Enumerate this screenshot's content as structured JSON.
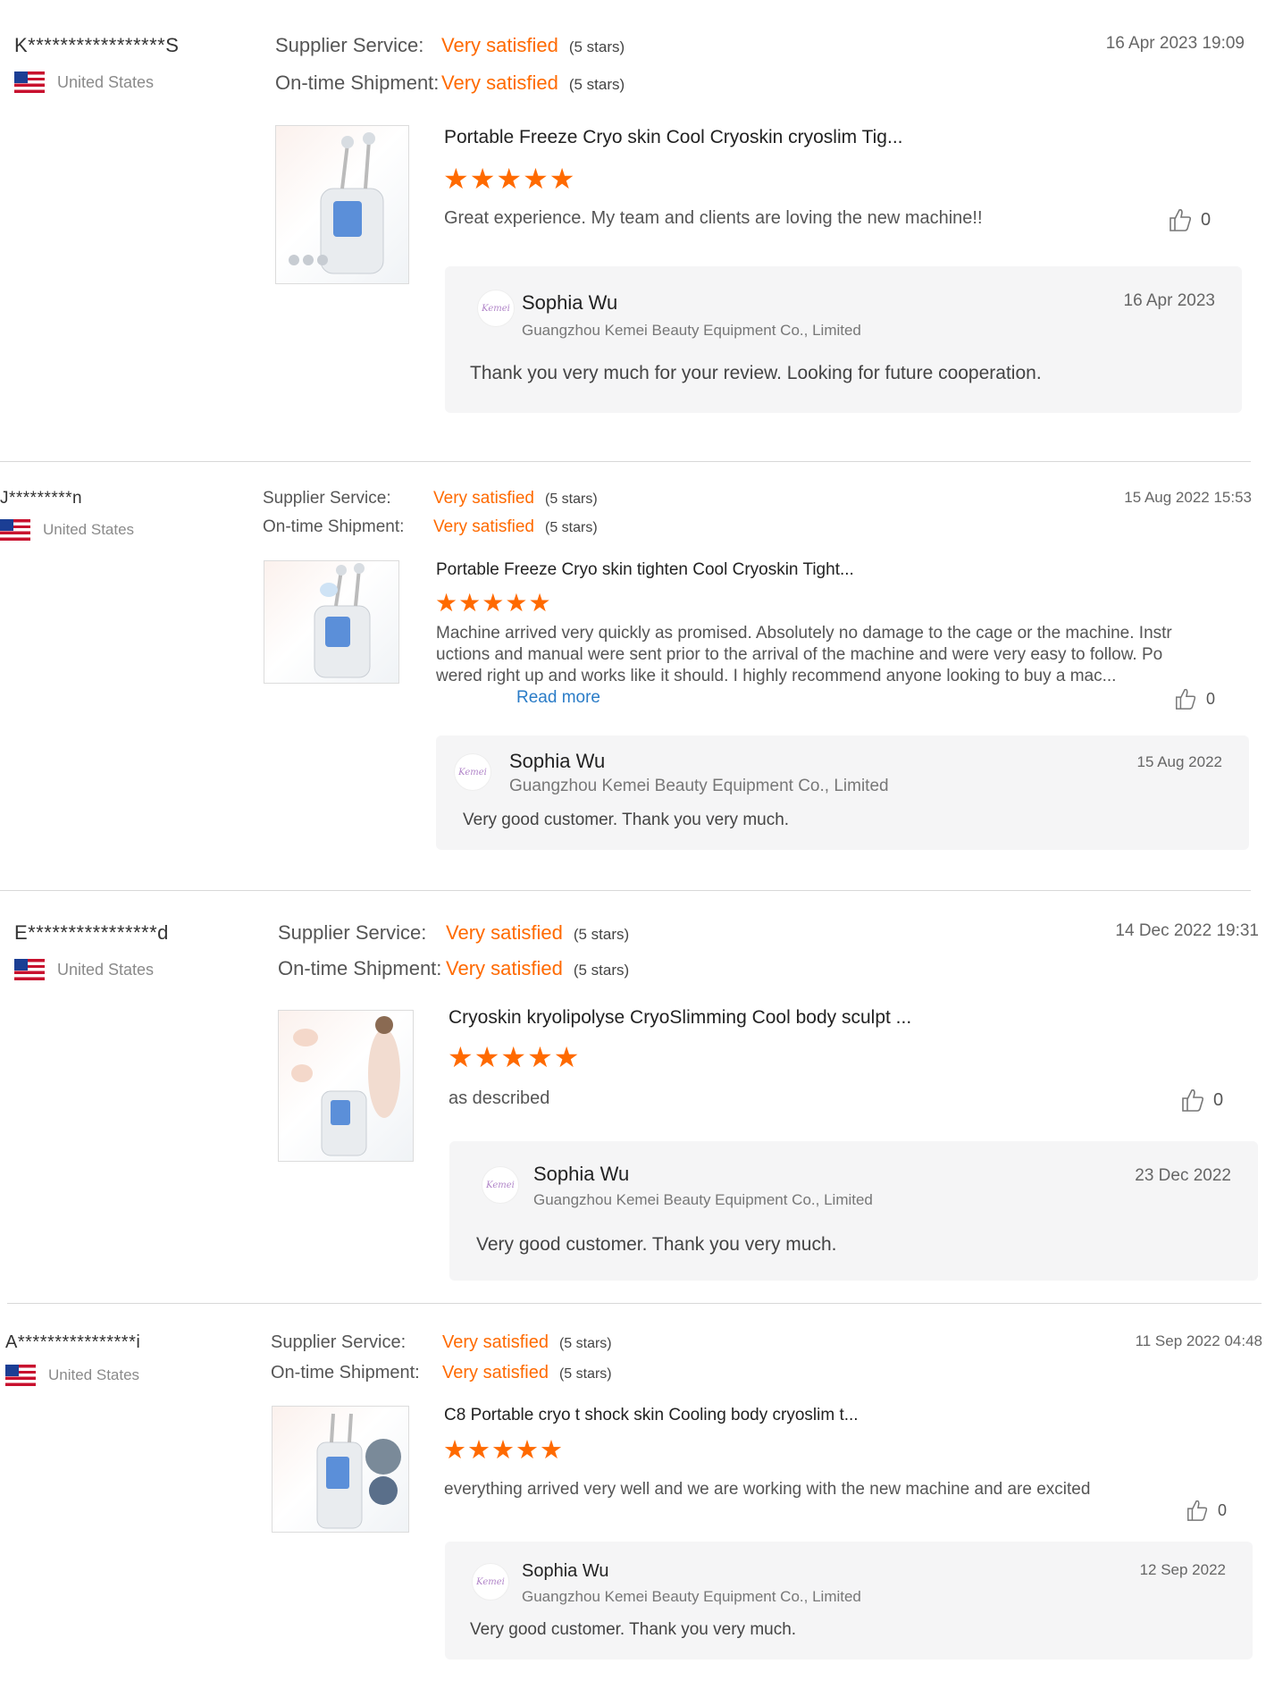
{
  "reviews": [
    {
      "buyer": "K*****************S",
      "country": "United States",
      "supplier_label": "Supplier Service:",
      "supplier_value": "Very satisfied",
      "supplier_stars": "(5 stars)",
      "shipment_label": "On-time Shipment:",
      "shipment_value": "Very satisfied",
      "shipment_stars": "(5 stars)",
      "date": "16 Apr 2023 19:09",
      "product_title": "Portable Freeze Cryo skin Cool Cryoskin cryoslim Tig...",
      "rating": 5,
      "text": "Great experience. My team and clients are loving the new machine!!",
      "read_more": "",
      "likes": "0",
      "reply": {
        "name": "Sophia Wu",
        "company": "Guangzhou Kemei Beauty Equipment Co., Limited",
        "date": "16 Apr 2023",
        "text": "Thank you very much for your review. Looking for future cooperation."
      }
    },
    {
      "buyer": "J*********n",
      "country": "United States",
      "supplier_label": "Supplier Service:",
      "supplier_value": "Very satisfied",
      "supplier_stars": "(5 stars)",
      "shipment_label": "On-time Shipment:",
      "shipment_value": "Very satisfied",
      "shipment_stars": "(5 stars)",
      "date": "15 Aug 2022 15:53",
      "product_title": "Portable Freeze Cryo skin tighten Cool Cryoskin Tight...",
      "rating": 5,
      "text": "Machine arrived very quickly as promised. Absolutely no damage to the cage or the machine. Instructions and manual were sent prior to the arrival of the machine and were very easy to follow. Powered right up and works like it should. I highly recommend anyone looking to buy a mac...",
      "read_more": "Read more",
      "likes": "0",
      "reply": {
        "name": "Sophia Wu",
        "company": "Guangzhou Kemei Beauty Equipment Co., Limited",
        "date": "15 Aug 2022",
        "text": "Very good customer. Thank you very much."
      }
    },
    {
      "buyer": "E****************d",
      "country": "United States",
      "supplier_label": "Supplier Service:",
      "supplier_value": "Very satisfied",
      "supplier_stars": "(5 stars)",
      "shipment_label": "On-time Shipment:",
      "shipment_value": "Very satisfied",
      "shipment_stars": "(5 stars)",
      "date": "14 Dec 2022 19:31",
      "product_title": "Cryoskin kryolipolyse CryoSlimming Cool body sculpt ...",
      "rating": 5,
      "text": "as described",
      "read_more": "",
      "likes": "0",
      "reply": {
        "name": "Sophia Wu",
        "company": "Guangzhou Kemei Beauty Equipment Co., Limited",
        "date": "23 Dec 2022",
        "text": "Very good customer. Thank you very much."
      }
    },
    {
      "buyer": "A****************i",
      "country": "United States",
      "supplier_label": "Supplier Service:",
      "supplier_value": "Very satisfied",
      "supplier_stars": "(5 stars)",
      "shipment_label": "On-time Shipment:",
      "shipment_value": "Very satisfied",
      "shipment_stars": "(5 stars)",
      "date": "11 Sep 2022 04:48",
      "product_title": "C8 Portable cryo t shock skin Cooling body cryoslim t...",
      "rating": 5,
      "text": "everything arrived very well and we are working with the new machine and are excited",
      "read_more": "",
      "likes": "0",
      "reply": {
        "name": "Sophia Wu",
        "company": "Guangzhou Kemei Beauty Equipment Co., Limited",
        "date": "12 Sep 2022",
        "text": "Very good customer. Thank you very much."
      }
    }
  ],
  "colors": {
    "accent": "#ff6a00",
    "link": "#2a7cc7",
    "reply_bg": "#f5f5f6"
  },
  "icons": {
    "flag": "us-flag-icon",
    "like": "thumbs-up-icon",
    "star": "star-icon",
    "avatar": "supplier-logo"
  }
}
